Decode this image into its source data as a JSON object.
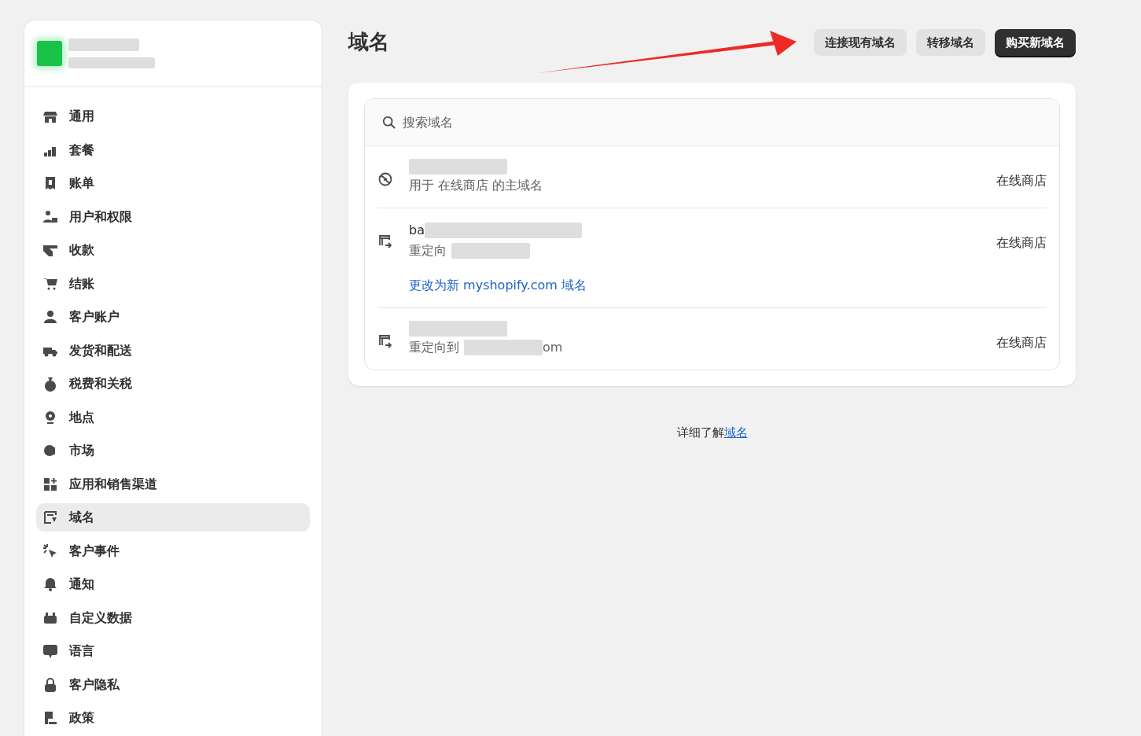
{
  "sidebar": {
    "items": [
      {
        "label": "通用",
        "selected": false
      },
      {
        "label": "套餐",
        "selected": false
      },
      {
        "label": "账单",
        "selected": false
      },
      {
        "label": "用户和权限",
        "selected": false
      },
      {
        "label": "收款",
        "selected": false
      },
      {
        "label": "结账",
        "selected": false
      },
      {
        "label": "客户账户",
        "selected": false
      },
      {
        "label": "发货和配送",
        "selected": false
      },
      {
        "label": "税费和关税",
        "selected": false
      },
      {
        "label": "地点",
        "selected": false
      },
      {
        "label": "市场",
        "selected": false
      },
      {
        "label": "应用和销售渠道",
        "selected": false
      },
      {
        "label": "域名",
        "selected": true
      },
      {
        "label": "客户事件",
        "selected": false
      },
      {
        "label": "通知",
        "selected": false
      },
      {
        "label": "自定义数据",
        "selected": false
      },
      {
        "label": "语言",
        "selected": false
      },
      {
        "label": "客户隐私",
        "selected": false
      },
      {
        "label": "政策",
        "selected": false
      }
    ]
  },
  "page": {
    "title": "域名",
    "buttons": [
      {
        "label": "连接现有域名",
        "kind": "secondary"
      },
      {
        "label": "转移域名",
        "kind": "secondary"
      },
      {
        "label": "购买新域名",
        "kind": "primary"
      }
    ],
    "search": {
      "placeholder": "搜索域名"
    },
    "domains": [
      {
        "kind": "primary",
        "detail": "用于 在线商店 的主域名",
        "channel": "在线商店"
      },
      {
        "kind": "redirect",
        "name": "ba",
        "detail": "重定向",
        "channel": "在线商店",
        "link": "更改为新 myshopify.com 域名"
      },
      {
        "kind": "redirect",
        "detail": "重定向到",
        "detail_tail": "om",
        "channel": "在线商店"
      }
    ],
    "footer": {
      "text": "详细了解",
      "link": "域名"
    }
  }
}
